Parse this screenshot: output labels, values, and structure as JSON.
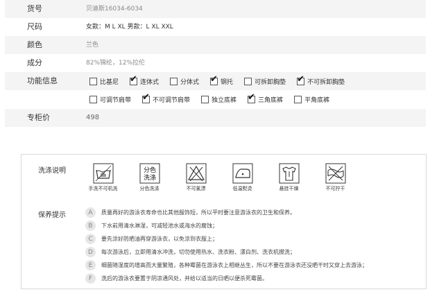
{
  "spec": {
    "item_no": {
      "label": "货号",
      "value": "贝迪斯16034-6034"
    },
    "size": {
      "label": "尺码",
      "value": "女款：M  L  XL  男款：L  XL  XXL"
    },
    "color": {
      "label": "颜色",
      "value": "兰色"
    },
    "material": {
      "label": "成分",
      "value": "82%锦纶，12%拉伦"
    },
    "features": {
      "label": "功能信息",
      "row1": [
        {
          "label": "比基尼",
          "checked": false
        },
        {
          "label": "连体式",
          "checked": true
        },
        {
          "label": "分体式",
          "checked": false
        },
        {
          "label": "钢托",
          "checked": true
        },
        {
          "label": "可拆卸胸垫",
          "checked": false
        },
        {
          "label": "不可拆卸胸垫",
          "checked": true
        }
      ],
      "row2": [
        {
          "label": "可调节肩带",
          "checked": false
        },
        {
          "label": "不可调节肩带",
          "checked": true
        },
        {
          "label": "独立底裤",
          "checked": false
        },
        {
          "label": "三角底裤",
          "checked": true
        },
        {
          "label": "平角底裤",
          "checked": false
        }
      ]
    },
    "price": {
      "label": "专柜价",
      "value": "498"
    }
  },
  "care": {
    "wash_label": "洗涤说明",
    "symbols": [
      {
        "icon": "hand-wash-icon",
        "caption": "手洗不可机洗"
      },
      {
        "icon": "separate-wash-icon",
        "caption": "分色洗涤",
        "text_top": "分色",
        "text_bottom": "洗涤"
      },
      {
        "icon": "no-bleach-icon",
        "caption": "不可氯漂"
      },
      {
        "icon": "low-iron-icon",
        "caption": "低温熨烫"
      },
      {
        "icon": "hang-dry-icon",
        "caption": "悬挂干燥"
      },
      {
        "icon": "no-wring-icon",
        "caption": "不可拧干"
      }
    ],
    "tips_label": "保养提示",
    "tips": [
      {
        "letter": "A",
        "text": "质量再好的游泳衣寿命也比其他服饰短，所以平时要注意游泳衣的卫生和保养。"
      },
      {
        "letter": "B",
        "text": "下水前用清水淋湿，可减轻池水或海水的腐蚀；"
      },
      {
        "letter": "C",
        "text": "要先涂好防晒油再穿游泳衣，以免涂到衣服上；"
      },
      {
        "letter": "D",
        "text": "每次游泳后，立即用清水冲洗，切勿使用热水、洗衣粉、漂白剂、洗衣机搅洗；"
      },
      {
        "letter": "E",
        "text": "细菌随湿度的增高而大量繁殖，各种霉菌在游泳衣上相继丛生，所以不要在游泳衣还没晒干时又穿上去游泳；"
      },
      {
        "letter": "F",
        "text": "洗后的游泳衣要置于阴凉通风处，并给以适当的日晒以便杀死霉菌。"
      }
    ]
  }
}
